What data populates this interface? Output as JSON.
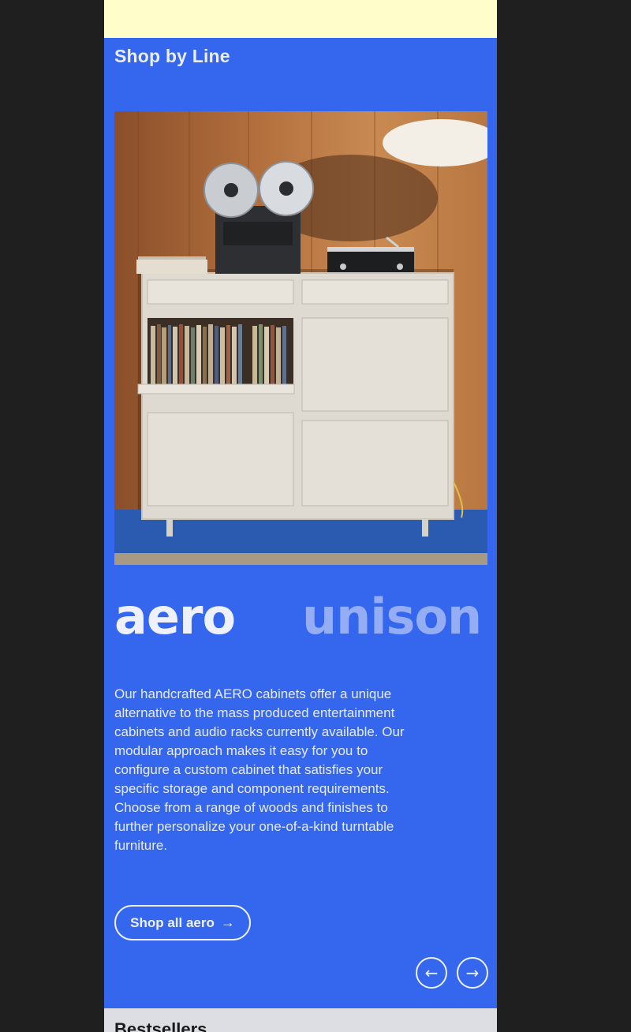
{
  "section": {
    "title": "Shop by Line"
  },
  "hero": {
    "image_alt": "white aero cabinet with reel-to-reel tape deck and turntable"
  },
  "lines": [
    {
      "label": "aero",
      "active": true
    },
    {
      "label": "unison",
      "active": false
    }
  ],
  "description": "Our handcrafted AERO cabinets offer a unique alternative to the mass produced entertainment cabinets and audio racks currently available. Our modular approach makes it easy for you to configure a custom cabinet that satisfies your specific storage and component requirements. Choose from a range of woods and finishes to further personalize your one-of-a-kind turntable furniture.",
  "cta": {
    "label": "Shop all aero",
    "icon": "arrow-right-icon"
  },
  "carousel": {
    "prev_icon": "arrow-left-icon",
    "next_icon": "arrow-right-icon"
  },
  "next_section": {
    "title": "Bestsellers"
  },
  "colors": {
    "brand_blue": "#3467ee",
    "banner_yellow": "#fffdc9",
    "text_light": "#eef1fa",
    "inactive_line": "#95adf4"
  }
}
